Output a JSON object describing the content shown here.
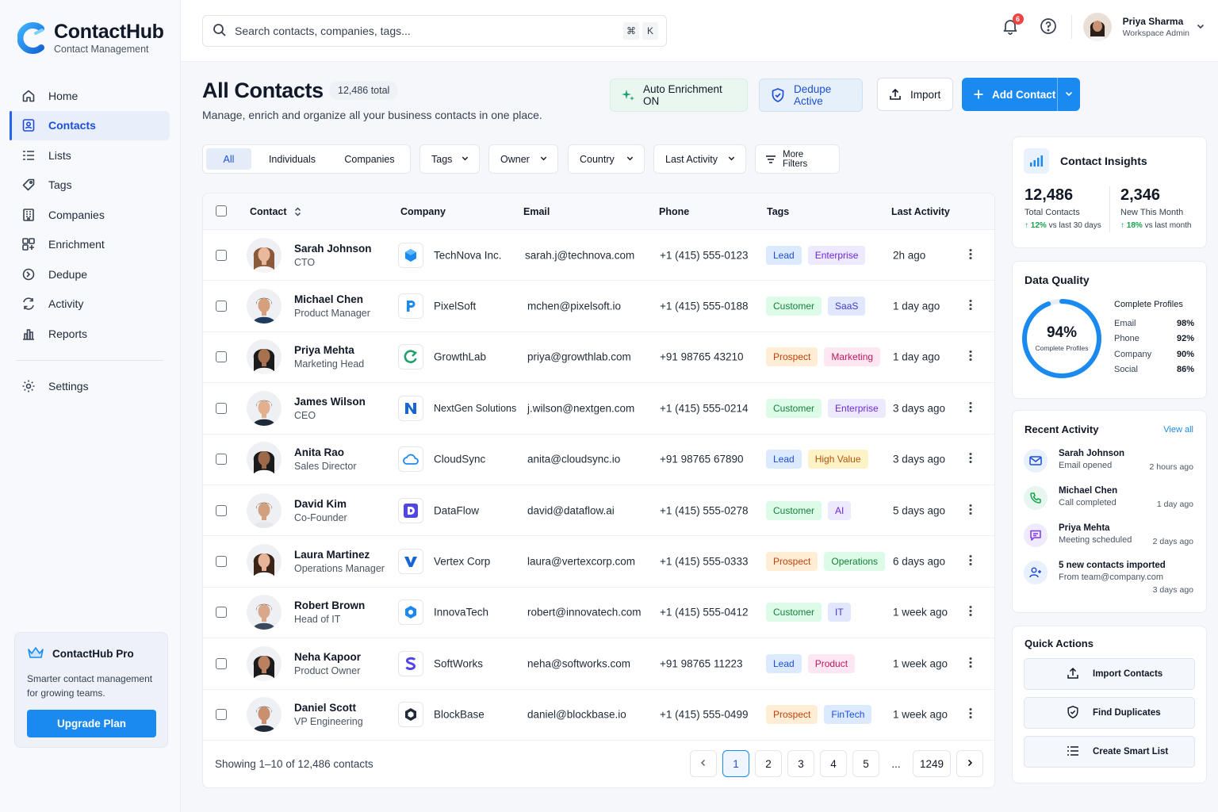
{
  "brand": {
    "name": "ContactHub",
    "tagline": "Contact Management"
  },
  "nav": {
    "items": [
      {
        "label": "Home",
        "icon": "home-icon"
      },
      {
        "label": "Contacts",
        "icon": "contacts-icon",
        "active": true
      },
      {
        "label": "Lists",
        "icon": "list-icon"
      },
      {
        "label": "Tags",
        "icon": "tag-icon"
      },
      {
        "label": "Companies",
        "icon": "building-icon"
      },
      {
        "label": "Enrichment",
        "icon": "grid-plus-icon"
      },
      {
        "label": "Dedupe",
        "icon": "dedupe-icon"
      },
      {
        "label": "Activity",
        "icon": "activity-icon"
      },
      {
        "label": "Reports",
        "icon": "chart-icon"
      }
    ],
    "settings": "Settings"
  },
  "pro": {
    "title": "ContactHub Pro",
    "text": "Smarter contact management for growing teams.",
    "button": "Upgrade Plan"
  },
  "search": {
    "placeholder": "Search contacts, companies, tags...",
    "kbd1": "⌘",
    "kbd2": "K"
  },
  "notifications": {
    "count": "6"
  },
  "user": {
    "name": "Priya Sharma",
    "role": "Workspace Admin"
  },
  "header": {
    "title": "All Contacts",
    "total": "12,486 total",
    "subtitle": "Manage, enrich and organize all your business contacts in one place.",
    "enrich": "Auto Enrichment ON",
    "dedupe": "Dedupe Active",
    "import": "Import",
    "add": "Add Contact"
  },
  "filters": {
    "segments": [
      "All",
      "Individuals",
      "Companies"
    ],
    "tags": "Tags",
    "owner": "Owner",
    "country": "Country",
    "last_activity": "Last Activity",
    "more": "More Filters"
  },
  "table": {
    "columns": {
      "contact": "Contact",
      "company": "Company",
      "email": "Email",
      "phone": "Phone",
      "tags": "Tags",
      "last_activity": "Last Activity"
    },
    "rows": [
      {
        "name": "Sarah Johnson",
        "title": "CTO",
        "company": "TechNova Inc.",
        "email": "sarah.j@technova.com",
        "phone": "+1 (415) 555-0123",
        "tags": [
          "Lead",
          "Enterprise"
        ],
        "activity": "2h ago"
      },
      {
        "name": "Michael Chen",
        "title": "Product Manager",
        "company": "PixelSoft",
        "email": "mchen@pixelsoft.io",
        "phone": "+1 (415) 555-0188",
        "tags": [
          "Customer",
          "SaaS"
        ],
        "activity": "1 day ago"
      },
      {
        "name": "Priya Mehta",
        "title": "Marketing Head",
        "company": "GrowthLab",
        "email": "priya@growthlab.com",
        "phone": "+91 98765 43210",
        "tags": [
          "Prospect",
          "Marketing"
        ],
        "activity": "1 day ago"
      },
      {
        "name": "James Wilson",
        "title": "CEO",
        "company": "NextGen Solutions",
        "email": "j.wilson@nextgen.com",
        "phone": "+1 (415) 555-0214",
        "tags": [
          "Customer",
          "Enterprise"
        ],
        "activity": "3 days ago"
      },
      {
        "name": "Anita Rao",
        "title": "Sales Director",
        "company": "CloudSync",
        "email": "anita@cloudsync.io",
        "phone": "+91 98765 67890",
        "tags": [
          "Lead",
          "High Value"
        ],
        "activity": "3 days ago"
      },
      {
        "name": "David Kim",
        "title": "Co-Founder",
        "company": "DataFlow",
        "email": "david@dataflow.ai",
        "phone": "+1 (415) 555-0278",
        "tags": [
          "Customer",
          "AI"
        ],
        "activity": "5 days ago"
      },
      {
        "name": "Laura Martinez",
        "title": "Operations Manager",
        "company": "Vertex Corp",
        "email": "laura@vertexcorp.com",
        "phone": "+1 (415) 555-0333",
        "tags": [
          "Prospect",
          "Operations"
        ],
        "activity": "6 days ago"
      },
      {
        "name": "Robert Brown",
        "title": "Head of IT",
        "company": "InnovaTech",
        "email": "robert@innovatech.com",
        "phone": "+1 (415) 555-0412",
        "tags": [
          "Customer",
          "IT"
        ],
        "activity": "1 week ago"
      },
      {
        "name": "Neha Kapoor",
        "title": "Product Owner",
        "company": "SoftWorks",
        "email": "neha@softworks.com",
        "phone": "+91 98765 11223",
        "tags": [
          "Lead",
          "Product"
        ],
        "activity": "1 week ago"
      },
      {
        "name": "Daniel Scott",
        "title": "VP Engineering",
        "company": "BlockBase",
        "email": "daniel@blockbase.io",
        "phone": "+1 (415) 555-0499",
        "tags": [
          "Prospect",
          "FinTech"
        ],
        "activity": "1 week ago"
      }
    ],
    "showing": "Showing 1–10 of 12,486 contacts",
    "pages": [
      "1",
      "2",
      "3",
      "4",
      "5",
      "...",
      "1249"
    ],
    "current_page": "1"
  },
  "insights": {
    "title": "Contact Insights",
    "total": {
      "value": "12,486",
      "label": "Total Contacts",
      "change": "12%",
      "period": "vs last 30 days"
    },
    "new": {
      "value": "2,346",
      "label": "New This Month",
      "change": "18%",
      "period": "vs last month"
    }
  },
  "quality": {
    "title": "Data Quality",
    "percent": "94%",
    "percent_value": 94,
    "ring_label": "Complete Profiles",
    "list_title": "Complete Profiles",
    "items": [
      {
        "label": "Email",
        "value": "98%"
      },
      {
        "label": "Phone",
        "value": "92%"
      },
      {
        "label": "Company",
        "value": "90%"
      },
      {
        "label": "Social",
        "value": "86%"
      }
    ]
  },
  "activity": {
    "title": "Recent Activity",
    "view_all": "View all",
    "items": [
      {
        "name": "Sarah Johnson",
        "desc": "Email opened",
        "time": "2 hours ago"
      },
      {
        "name": "Michael Chen",
        "desc": "Call completed",
        "time": "1 day ago"
      },
      {
        "name": "Priya Mehta",
        "desc": "Meeting scheduled",
        "time": "2 days ago"
      },
      {
        "name": "5 new contacts imported",
        "desc": "From team@company.com",
        "time": "3 days ago"
      }
    ]
  },
  "quick": {
    "title": "Quick Actions",
    "items": [
      "Import Contacts",
      "Find Duplicates",
      "Create Smart List"
    ]
  },
  "colors": {
    "accent": "#1a8af0",
    "active_nav": "#1d4ed8"
  }
}
